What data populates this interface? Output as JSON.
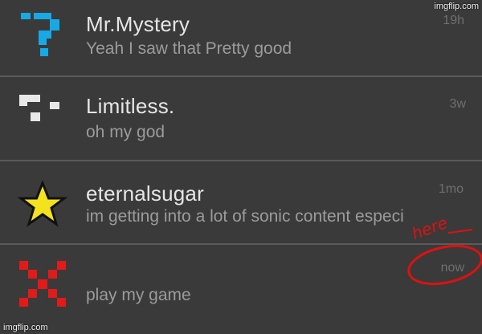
{
  "watermarks": {
    "top": "imgflip.com",
    "bottom": "imgflip.com"
  },
  "colors": {
    "background": "#3a3a3a",
    "name": "#e6e6e6",
    "message": "#9b9b9b",
    "time": "#6f6f6f",
    "annotation": "#e01010"
  },
  "conversations": [
    {
      "avatar_icon": "blue-question-mark-pixel-icon",
      "name": "Mr.Mystery",
      "message": "Yeah I saw that Pretty good",
      "time": "19h"
    },
    {
      "avatar_icon": "white-pixel-blocks-icon",
      "name": "Limitless.",
      "message": "oh my god",
      "time": "3w"
    },
    {
      "avatar_icon": "yellow-star-icon",
      "name": "eternalsugar",
      "message": "im getting into a lot of sonic content especi",
      "time": "1mo"
    },
    {
      "avatar_icon": "red-x-pixel-icon",
      "name": "",
      "message": "play my game",
      "time": "now"
    }
  ],
  "annotation": {
    "text": "here"
  }
}
